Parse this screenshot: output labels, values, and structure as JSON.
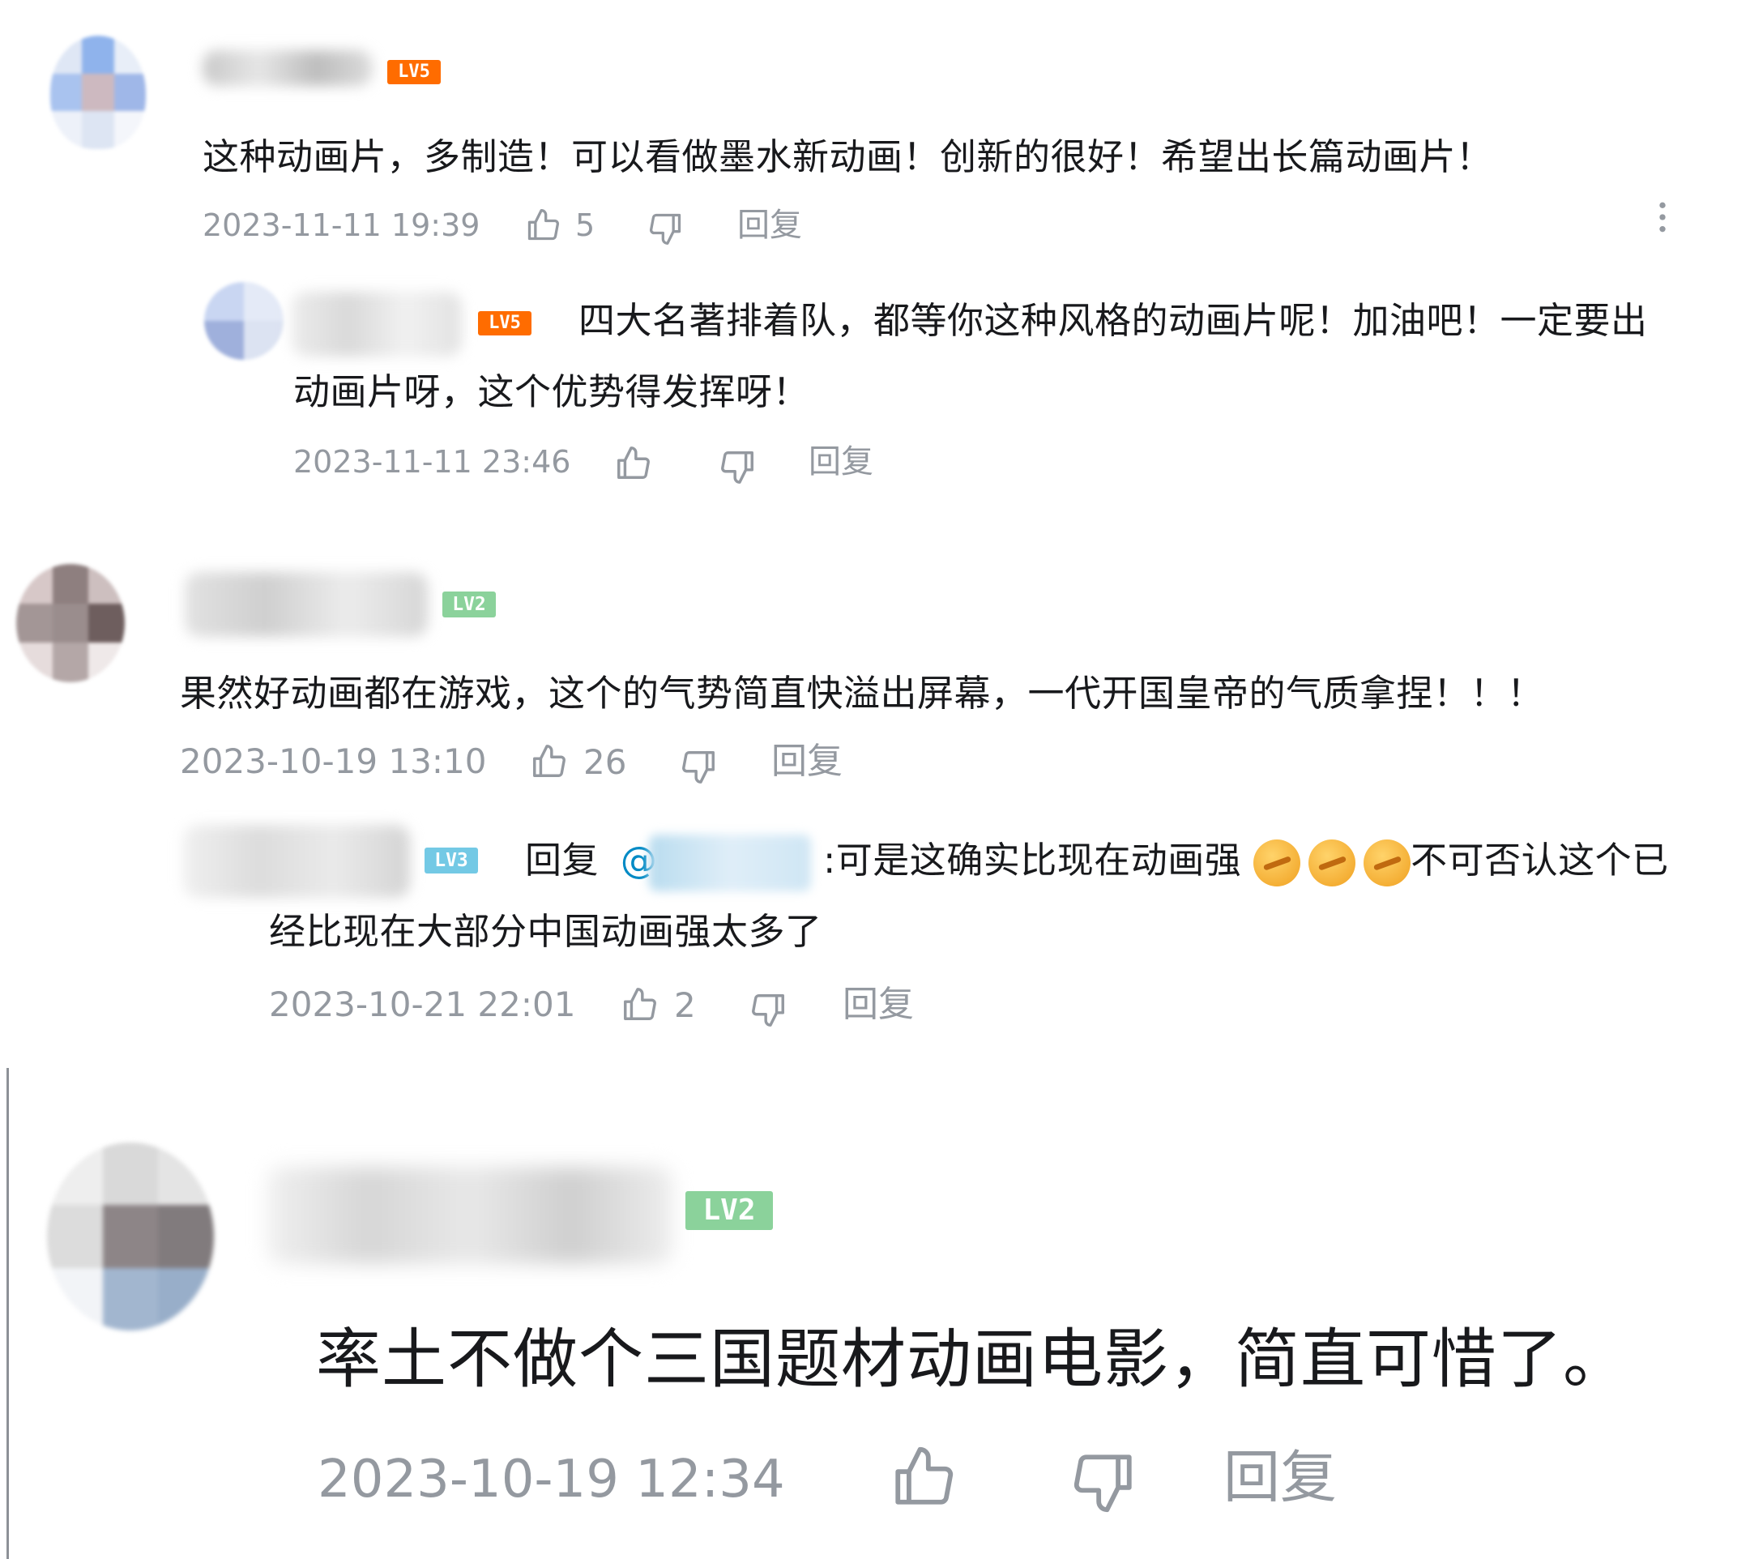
{
  "comments": [
    {
      "level": "LV5",
      "text": "这种动画片，多制造！可以看做墨水新动画！创新的很好！希望出长篇动画片！",
      "time": "2023-11-11 19:39",
      "likes": "5",
      "reply_label": "回复",
      "replies": [
        {
          "level": "LV5",
          "text_line1": "四大名著排着队，都等你这种风格的动画片呢！加油吧！一定要出",
          "text_line2": "动画片呀，这个优势得发挥呀！",
          "time": "2023-11-11 23:46",
          "reply_label": "回复"
        }
      ]
    },
    {
      "level": "LV2",
      "text": "果然好动画都在游戏，这个的气势简直快溢出屏幕，一代开国皇帝的气质拿捏！！！",
      "time": "2023-10-19 13:10",
      "likes": "26",
      "reply_label": "回复",
      "replies": [
        {
          "level": "LV3",
          "prefix": "回复",
          "at": "@",
          "text_line1_a": ":可是这确实比现在动画强",
          "text_line1_b": "不可否认这个已",
          "text_line2": "经比现在大部分中国动画强太多了",
          "time": "2023-10-21 22:01",
          "likes": "2",
          "reply_label": "回复"
        }
      ]
    },
    {
      "level": "LV2",
      "text": "率土不做个三国题材动画电影，简直可惜了。",
      "time": "2023-10-19 12:34",
      "reply_label": "回复"
    }
  ],
  "colors": {
    "lv5": "#ff6c00",
    "lv2": "#8bd29b",
    "lv3": "#73c9e5",
    "meta": "#9499a0",
    "text": "#18191c",
    "at": "#008ac5"
  },
  "icons": {
    "like": "thumbs-up-icon",
    "dislike": "thumbs-down-icon",
    "more": "more-vertical-icon"
  }
}
